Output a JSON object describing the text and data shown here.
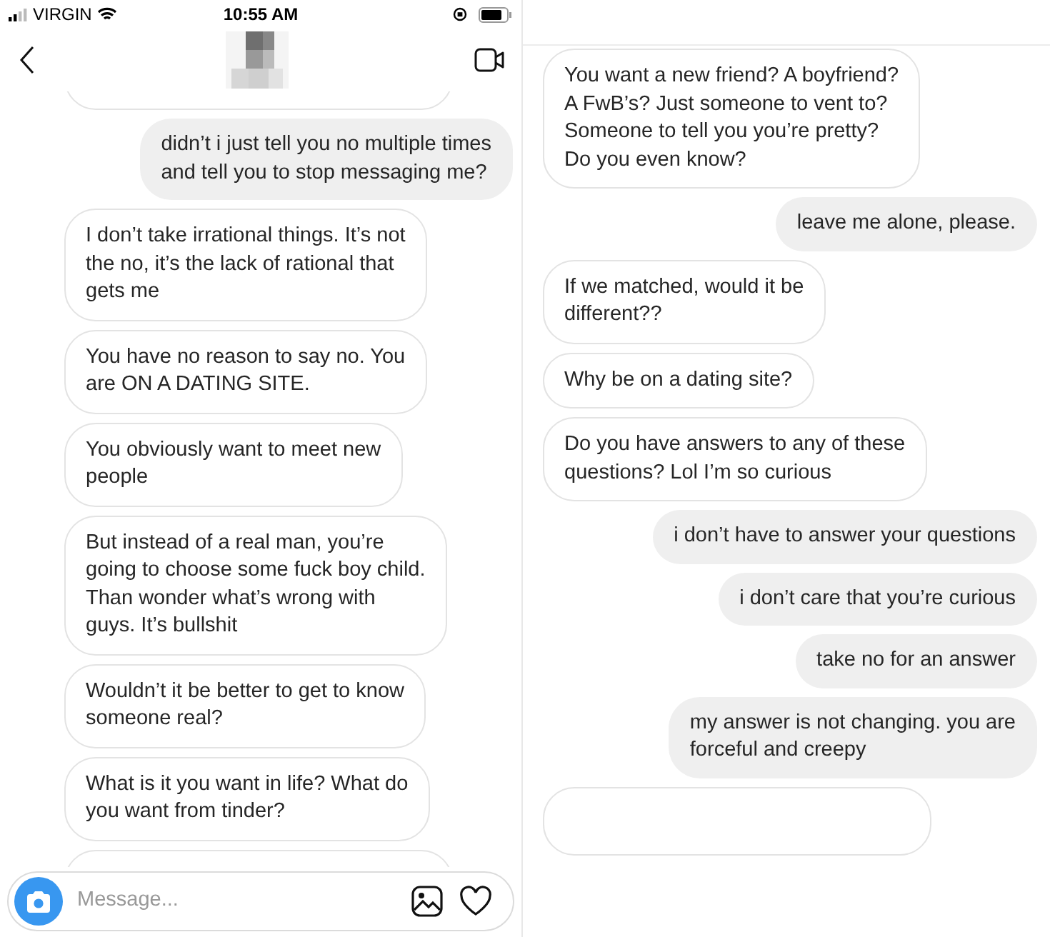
{
  "left_screen": {
    "status_bar": {
      "carrier": "VIRGIN",
      "time": "10:55 AM"
    },
    "messages": [
      {
        "kind": "fragment"
      },
      {
        "kind": "sent",
        "text": "didn’t i just tell you no multiple times\nand tell you to stop messaging me?"
      },
      {
        "kind": "received",
        "text": "I don’t take irrational things. It’s not\nthe no, it’s the lack of rational that\ngets me"
      },
      {
        "kind": "received",
        "text": "You have no reason to say no. You\nare ON A DATING SITE."
      },
      {
        "kind": "received",
        "text": "You obviously want to meet new\npeople"
      },
      {
        "kind": "received",
        "text": "But instead of a real man, you’re\ngoing to choose some fuck boy child.\nThan wonder what’s wrong with\nguys. It’s bullshit"
      },
      {
        "kind": "received",
        "text": "Wouldn’t it be better to get to know\nsomeone real?"
      },
      {
        "kind": "received",
        "text": "What is it you want in life? What do\nyou want from tinder?"
      },
      {
        "kind": "fragment"
      }
    ],
    "composer": {
      "placeholder": "Message..."
    }
  },
  "right_screen": {
    "messages": [
      {
        "kind": "received",
        "text": "You want a new friend? A boyfriend?\nA FwB’s? Just someone to vent to?\nSomeone to tell you you’re pretty?\nDo you even know?"
      },
      {
        "kind": "sent",
        "text": "leave me alone, please."
      },
      {
        "kind": "received",
        "text": "If we matched, would it be\ndifferent??"
      },
      {
        "kind": "received",
        "text": "Why be on a dating site?"
      },
      {
        "kind": "received",
        "text": "Do you have answers to any of these\nquestions? Lol I’m so curious"
      },
      {
        "kind": "sent",
        "text": "i don’t have to answer your questions"
      },
      {
        "kind": "sent",
        "text": "i don’t care that you’re curious"
      },
      {
        "kind": "sent",
        "text": "take no for an answer"
      },
      {
        "kind": "sent",
        "text": "my answer is not changing. you are\nforceful and creepy"
      },
      {
        "kind": "fragment"
      }
    ]
  }
}
